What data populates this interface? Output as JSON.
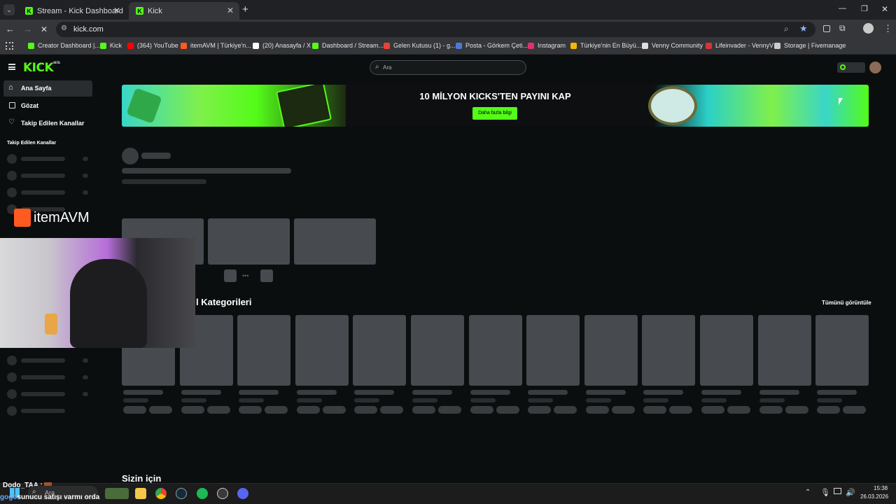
{
  "browser": {
    "tabs": [
      {
        "title": "Stream - Kick Dashboard",
        "active": false
      },
      {
        "title": "Kick",
        "active": true
      }
    ],
    "url": "kick.com",
    "bookmarks": [
      {
        "label": "Creator Dashboard |...",
        "color": "#53fc18"
      },
      {
        "label": "Kick",
        "color": "#53fc18"
      },
      {
        "label": "(364) YouTube",
        "color": "#ff0000"
      },
      {
        "label": "itemAVM | Türkiye'n...",
        "color": "#ff5a1f"
      },
      {
        "label": "(20) Anasayfa / X",
        "color": "#ffffff"
      },
      {
        "label": "Dashboard / Stream...",
        "color": "#53fc18"
      },
      {
        "label": "Gelen Kutusu (1) - g...",
        "color": "#ea4335"
      },
      {
        "label": "Posta - Görkem Çeti...",
        "color": "#4a7bd8"
      },
      {
        "label": "Instagram",
        "color": "#e1306c"
      },
      {
        "label": "Türkiye'nin En Büyü...",
        "color": "#f2b705"
      },
      {
        "label": "Venny Community",
        "color": "#dddddd"
      },
      {
        "label": "Lifeinvader - VennyV",
        "color": "#d9343a"
      },
      {
        "label": "Storage | Fivemanage",
        "color": "#cccccc"
      }
    ]
  },
  "site": {
    "logo": "KICK",
    "logo_badge": "BETA",
    "search_placeholder": "Ara",
    "nav": [
      {
        "label": "Ana Sayfa",
        "icon": "home-icon",
        "active": true
      },
      {
        "label": "Gözat",
        "icon": "browse-icon",
        "active": false
      },
      {
        "label": "Takip Edilen Kanallar",
        "icon": "heart-icon",
        "active": false
      }
    ],
    "followed_heading": "Takip Edilen Kanallar",
    "banner": {
      "title": "10 MİLYON KICKS'TEN PAYINI KAP",
      "button": "Daha fazla bilgi"
    },
    "categories_heading": "l Kategorileri",
    "view_all": "Tümünü görüntüle",
    "for_you_heading": "Sizin için"
  },
  "overlay": {
    "sponsor": "itemAVM",
    "chat_user": "Dodo_TAA :",
    "chat_line_user": "gogo",
    "chat_line_text": "sunucu satışı varmı orda"
  },
  "taskbar": {
    "search": "Ara",
    "time": "15:38",
    "date": "26.03.2026"
  },
  "colors": {
    "accent": "#53fc18",
    "bg": "#0b0e0f",
    "skeleton": "#3a3d40"
  }
}
